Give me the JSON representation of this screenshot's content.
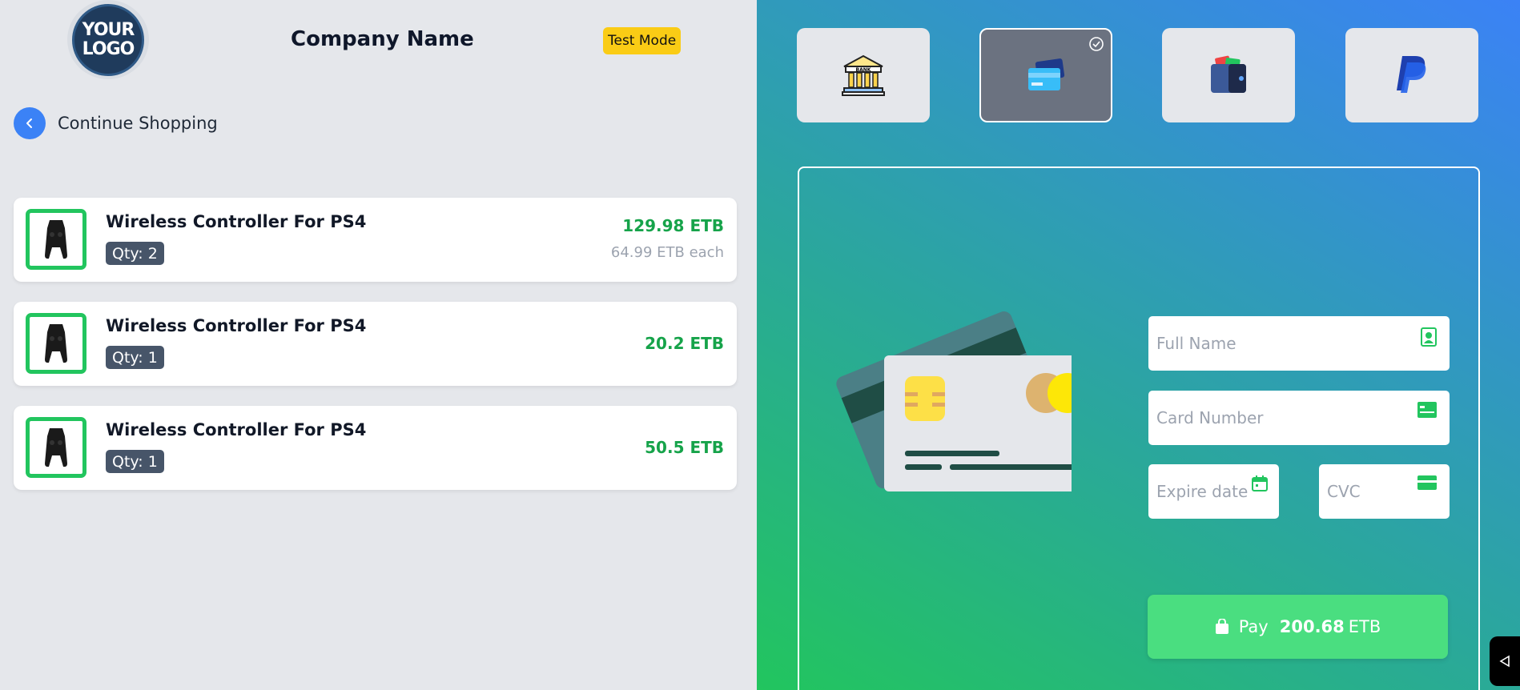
{
  "header": {
    "logo_line1": "YOUR",
    "logo_line2": "LOGO",
    "company_name": "Company Name",
    "test_mode_label": "Test Mode"
  },
  "nav": {
    "continue_label": "Continue Shopping"
  },
  "cart": {
    "items": [
      {
        "title": "Wireless Controller For PS4",
        "qty": "Qty: 2",
        "price": "129.98 ETB",
        "each": "64.99 ETB each"
      },
      {
        "title": "Wireless Controller For PS4",
        "qty": "Qty: 1",
        "price": "20.2 ETB",
        "each": ""
      },
      {
        "title": "Wireless Controller For PS4",
        "qty": "Qty: 1",
        "price": "50.5 ETB",
        "each": ""
      }
    ]
  },
  "payment_methods": [
    {
      "name": "bank",
      "icon": "bank-icon",
      "label": "BANK",
      "selected": false
    },
    {
      "name": "card",
      "icon": "credit-card-icon",
      "selected": true
    },
    {
      "name": "wallet",
      "icon": "wallet-icon",
      "selected": false
    },
    {
      "name": "paypal",
      "icon": "paypal-icon",
      "selected": false
    }
  ],
  "form": {
    "full_name_placeholder": "Full Name",
    "card_number_placeholder": "Card Number",
    "expire_placeholder": "Expire date",
    "cvc_placeholder": "CVC"
  },
  "pay": {
    "label": "Pay",
    "amount": "200.68",
    "currency": "ETB"
  },
  "colors": {
    "accent_green": "#22c55e",
    "price_green": "#16a34a",
    "blue": "#3b82f6",
    "badge_yellow": "#facc15"
  }
}
